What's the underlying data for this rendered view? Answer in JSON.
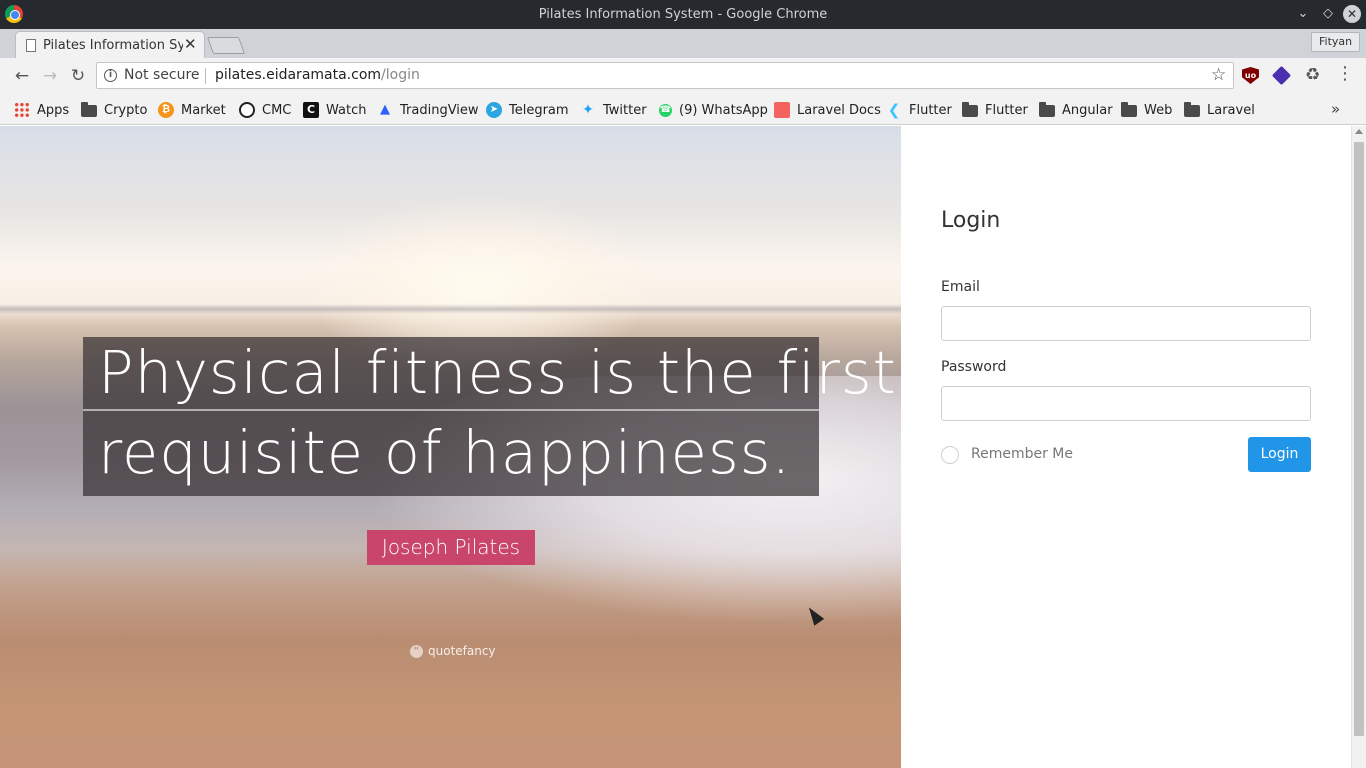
{
  "window": {
    "title": "Pilates Information System - Google Chrome"
  },
  "tabs": [
    {
      "label": "Pilates Information System",
      "active": true
    }
  ],
  "profile": {
    "name": "Fityan"
  },
  "omnibox": {
    "security": "Not secure",
    "url_host": "pilates.eidaramata.com",
    "url_path": "/login"
  },
  "bookmarks": [
    {
      "label": "Apps",
      "icon": "apps-icon"
    },
    {
      "label": "Crypto",
      "icon": "folder-icon"
    },
    {
      "label": "Market",
      "icon": "bitcoin-icon"
    },
    {
      "label": "CMC",
      "icon": "coinmarketcap-icon"
    },
    {
      "label": "Watch",
      "icon": "cryptowat-icon"
    },
    {
      "label": "TradingView",
      "icon": "tradingview-icon"
    },
    {
      "label": "Telegram",
      "icon": "telegram-icon"
    },
    {
      "label": "Twitter",
      "icon": "twitter-icon"
    },
    {
      "label": "(9) WhatsApp",
      "icon": "whatsapp-icon"
    },
    {
      "label": "Laravel Docs",
      "icon": "laravel-icon"
    },
    {
      "label": "Flutter",
      "icon": "flutter-icon"
    },
    {
      "label": "Flutter",
      "icon": "folder-icon"
    },
    {
      "label": "Angular",
      "icon": "folder-icon"
    },
    {
      "label": "Web",
      "icon": "folder-icon"
    },
    {
      "label": "Laravel",
      "icon": "folder-icon"
    }
  ],
  "hero": {
    "quote_line1": "Physical fitness is the first",
    "quote_line2": "requisite of happiness.",
    "author": "Joseph Pilates",
    "watermark": "quotefancy"
  },
  "login": {
    "title": "Login",
    "email_label": "Email",
    "email_value": "",
    "password_label": "Password",
    "password_value": "",
    "remember_label": "Remember Me",
    "remember_checked": false,
    "button_label": "Login",
    "button_color": "#2196e8"
  }
}
